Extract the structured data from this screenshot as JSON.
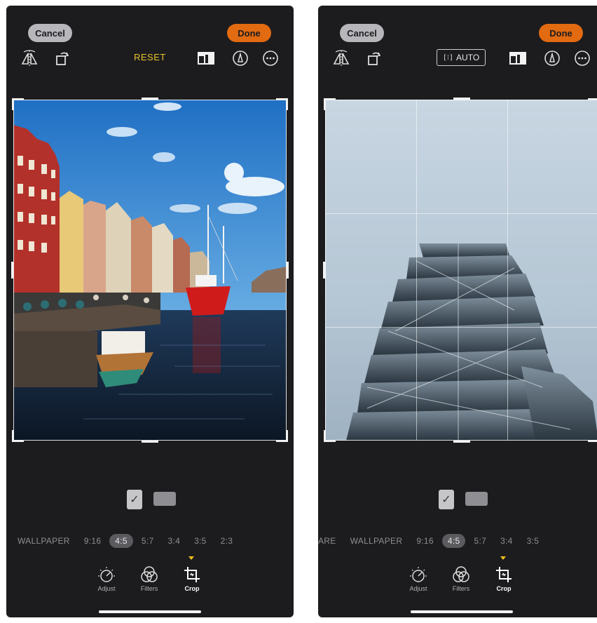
{
  "left_screen": {
    "cancel_label": "Cancel",
    "done_label": "Done",
    "reset_label": "RESET",
    "aspect_ratios": [
      "WALLPAPER",
      "9:16",
      "4:5",
      "5:7",
      "3:4",
      "3:5",
      "2:3"
    ],
    "selected_ratio": "4:5",
    "tools": [
      {
        "label": "Adjust",
        "icon": "adjust-dial-icon"
      },
      {
        "label": "Filters",
        "icon": "filters-icon"
      },
      {
        "label": "Crop",
        "icon": "crop-icon"
      }
    ],
    "active_tool": "Crop"
  },
  "right_screen": {
    "cancel_label": "Cancel",
    "done_label": "Done",
    "auto_label": "AUTO",
    "aspect_ratios": [
      "ARE",
      "WALLPAPER",
      "9:16",
      "4:5",
      "5:7",
      "3:4",
      "3:5"
    ],
    "selected_ratio": "4:5",
    "tools": [
      {
        "label": "Adjust",
        "icon": "adjust-dial-icon"
      },
      {
        "label": "Filters",
        "icon": "filters-icon"
      },
      {
        "label": "Crop",
        "icon": "crop-icon"
      }
    ],
    "active_tool": "Crop"
  },
  "colors": {
    "accent_done": "#e26a10",
    "reset_yellow": "#e9c12b",
    "background": "#1c1c1e"
  }
}
